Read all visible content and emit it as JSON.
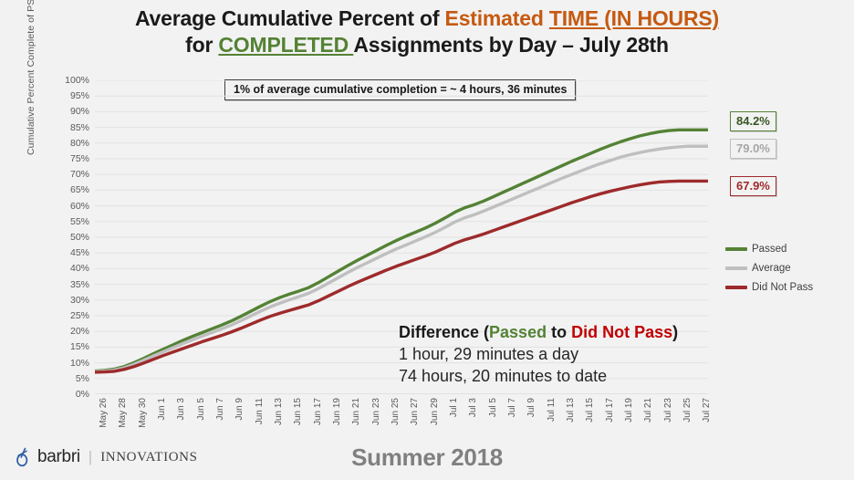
{
  "title": {
    "line1_a": "Average Cumulative Percent of ",
    "line1_b": "Estimated ",
    "line1_c": "TIME (IN HOURS)",
    "line2_a": "for ",
    "line2_b": "COMPLETED ",
    "line2_c": "Assignments by Day – July 28th"
  },
  "note": "1% of average cumulative completion = ~ 4 hours, 36 minutes",
  "callouts": {
    "passed": "84.2%",
    "average": "79.0%",
    "did_not_pass": "67.9%"
  },
  "legend": [
    {
      "label": "Passed",
      "color": "#548235"
    },
    {
      "label": "Average",
      "color": "#BFBFBF"
    },
    {
      "label": "Did Not Pass",
      "color": "#9E2A2B"
    }
  ],
  "difference": {
    "head_a": "Difference (",
    "head_b": "Passed",
    "head_c": " to ",
    "head_d": "Did Not Pass",
    "head_e": ")",
    "line2": "1 hour, 29 minutes a day",
    "line3": "74 hours, 20 minutes to date"
  },
  "footer": {
    "brand": "barbri",
    "divider": "|",
    "sub": "INNOVATIONS",
    "season": "Summer 2018"
  },
  "chart_data": {
    "type": "line",
    "title": "Average Cumulative Percent of Estimated TIME (IN HOURS) for COMPLETED Assignments by Day – July 28th",
    "xlabel": "",
    "ylabel": "Cumulative Percent Complete of PSP",
    "ylim": [
      0,
      100
    ],
    "ytick_step": 5,
    "ytick_labels": [
      "0%",
      "5%",
      "10%",
      "15%",
      "20%",
      "25%",
      "30%",
      "35%",
      "40%",
      "45%",
      "50%",
      "55%",
      "60%",
      "65%",
      "70%",
      "75%",
      "80%",
      "85%",
      "90%",
      "95%",
      "100%"
    ],
    "grid": "horizontal",
    "legend_position": "right",
    "x": [
      "May 26",
      "May 27",
      "May 28",
      "May 29",
      "May 30",
      "May 31",
      "Jun 1",
      "Jun 2",
      "Jun 3",
      "Jun 4",
      "Jun 5",
      "Jun 6",
      "Jun 7",
      "Jun 8",
      "Jun 9",
      "Jun 10",
      "Jun 11",
      "Jun 12",
      "Jun 13",
      "Jun 14",
      "Jun 15",
      "Jun 16",
      "Jun 17",
      "Jun 18",
      "Jun 19",
      "Jun 20",
      "Jun 21",
      "Jun 22",
      "Jun 23",
      "Jun 24",
      "Jun 25",
      "Jun 26",
      "Jun 27",
      "Jun 28",
      "Jun 29",
      "Jun 30",
      "Jul 1",
      "Jul 2",
      "Jul 3",
      "Jul 4",
      "Jul 5",
      "Jul 6",
      "Jul 7",
      "Jul 8",
      "Jul 9",
      "Jul 10",
      "Jul 11",
      "Jul 12",
      "Jul 13",
      "Jul 14",
      "Jul 15",
      "Jul 16",
      "Jul 17",
      "Jul 18",
      "Jul 19",
      "Jul 20",
      "Jul 21",
      "Jul 22",
      "Jul 23",
      "Jul 24",
      "Jul 25",
      "Jul 26",
      "Jul 27",
      "Jul 28"
    ],
    "xtick_labels": [
      "May 26",
      "May 28",
      "May 30",
      "Jun 1",
      "Jun 3",
      "Jun 5",
      "Jun 7",
      "Jun 9",
      "Jun 11",
      "Jun 13",
      "Jun 15",
      "Jun 17",
      "Jun 19",
      "Jun 21",
      "Jun 23",
      "Jun 25",
      "Jun 27",
      "Jun 29",
      "Jul 1",
      "Jul 3",
      "Jul 5",
      "Jul 7",
      "Jul 9",
      "Jul 11",
      "Jul 13",
      "Jul 15",
      "Jul 17",
      "Jul 19",
      "Jul 21",
      "Jul 23",
      "Jul 25",
      "Jul 27"
    ],
    "series": [
      {
        "name": "Passed",
        "color": "#548235",
        "end_label": "84.2%",
        "values": [
          7.4,
          7.6,
          8.0,
          8.8,
          10.0,
          11.4,
          12.9,
          14.3,
          15.7,
          17.1,
          18.4,
          19.6,
          20.8,
          22.0,
          23.3,
          24.8,
          26.4,
          28.0,
          29.5,
          30.8,
          31.9,
          32.9,
          34.0,
          35.6,
          37.4,
          39.2,
          41.0,
          42.7,
          44.3,
          45.9,
          47.5,
          49.0,
          50.4,
          51.7,
          53.0,
          54.5,
          56.2,
          58.0,
          59.4,
          60.4,
          61.6,
          63.0,
          64.4,
          65.8,
          67.2,
          68.6,
          70.0,
          71.4,
          72.8,
          74.2,
          75.5,
          76.8,
          78.1,
          79.3,
          80.4,
          81.4,
          82.3,
          83.0,
          83.6,
          84.0,
          84.2,
          84.2,
          84.2,
          84.2
        ]
      },
      {
        "name": "Average",
        "color": "#BFBFBF",
        "end_label": "79.0%",
        "values": [
          7.2,
          7.4,
          7.7,
          8.4,
          9.5,
          10.8,
          12.2,
          13.5,
          14.8,
          16.1,
          17.3,
          18.5,
          19.6,
          20.8,
          22.0,
          23.4,
          24.9,
          26.4,
          27.8,
          29.0,
          30.1,
          31.1,
          32.2,
          33.7,
          35.4,
          37.1,
          38.8,
          40.4,
          41.9,
          43.4,
          44.9,
          46.3,
          47.6,
          48.9,
          50.2,
          51.6,
          53.2,
          54.9,
          56.2,
          57.2,
          58.4,
          59.7,
          61.0,
          62.3,
          63.6,
          64.9,
          66.2,
          67.5,
          68.8,
          70.0,
          71.2,
          72.4,
          73.5,
          74.5,
          75.5,
          76.3,
          77.0,
          77.6,
          78.1,
          78.5,
          78.8,
          79.0,
          79.0,
          79.0
        ]
      },
      {
        "name": "Did Not Pass",
        "color": "#9E2A2B",
        "end_label": "67.9%",
        "values": [
          7.0,
          7.1,
          7.3,
          7.9,
          8.8,
          9.9,
          11.1,
          12.3,
          13.4,
          14.5,
          15.6,
          16.7,
          17.7,
          18.7,
          19.8,
          21.0,
          22.3,
          23.6,
          24.8,
          25.8,
          26.7,
          27.6,
          28.5,
          29.8,
          31.3,
          32.8,
          34.3,
          35.7,
          37.0,
          38.3,
          39.6,
          40.8,
          41.9,
          43.0,
          44.1,
          45.3,
          46.7,
          48.1,
          49.2,
          50.1,
          51.1,
          52.2,
          53.3,
          54.4,
          55.5,
          56.6,
          57.7,
          58.8,
          59.9,
          61.0,
          62.0,
          63.0,
          63.9,
          64.7,
          65.4,
          66.1,
          66.7,
          67.2,
          67.6,
          67.8,
          67.9,
          67.9,
          67.9,
          67.9
        ]
      }
    ],
    "annotations": [
      {
        "text": "1% of average cumulative completion = ~ 4 hours, 36 minutes",
        "position": "top-center"
      },
      {
        "text": "Difference (Passed to Did Not Pass) 1 hour, 29 minutes a day; 74 hours, 20 minutes to date",
        "position": "inside-lower-right"
      }
    ]
  }
}
